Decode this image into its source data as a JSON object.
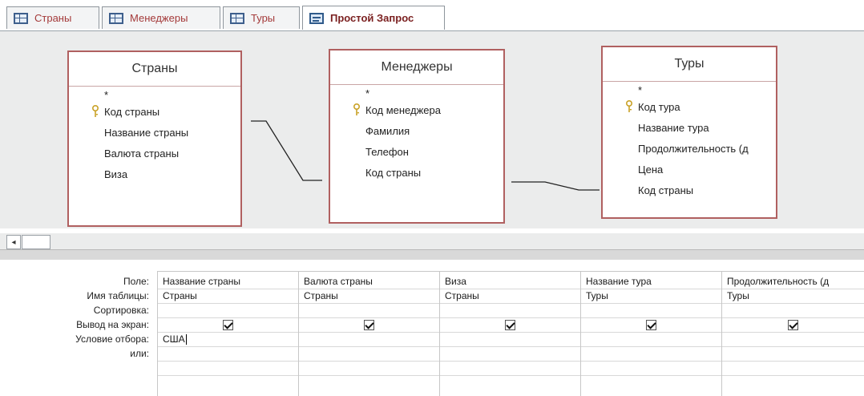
{
  "tabs": [
    {
      "label": "Страны",
      "icon": "table-icon"
    },
    {
      "label": "Менеджеры",
      "icon": "table-icon"
    },
    {
      "label": "Туры",
      "icon": "table-icon"
    },
    {
      "label": "Простой Запрос",
      "icon": "query-icon",
      "active": true
    }
  ],
  "tables": {
    "countries": {
      "title": "Страны",
      "star": "*",
      "fields": [
        "Код страны",
        "Название страны",
        "Валюта страны",
        "Виза"
      ],
      "key_field": "Код страны"
    },
    "managers": {
      "title": "Менеджеры",
      "star": "*",
      "fields": [
        "Код менеджера",
        "Фамилия",
        "Телефон",
        "Код страны"
      ],
      "key_field": "Код менеджера"
    },
    "tours": {
      "title": "Туры",
      "star": "*",
      "fields": [
        "Код тура",
        "Название тура",
        "Продолжительность (д",
        "Цена",
        "Код страны"
      ],
      "key_field": "Код тура"
    }
  },
  "grid": {
    "row_labels": [
      "Поле:",
      "Имя таблицы:",
      "Сортировка:",
      "Вывод на экран:",
      "Условие отбора:",
      "или:"
    ],
    "columns": [
      {
        "field": "Название страны",
        "table": "Страны",
        "sort": "",
        "show": true,
        "criteria": "США",
        "or": ""
      },
      {
        "field": "Валюта страны",
        "table": "Страны",
        "sort": "",
        "show": true,
        "criteria": "",
        "or": ""
      },
      {
        "field": "Виза",
        "table": "Страны",
        "sort": "",
        "show": true,
        "criteria": "",
        "or": ""
      },
      {
        "field": "Название тура",
        "table": "Туры",
        "sort": "",
        "show": true,
        "criteria": "",
        "or": ""
      },
      {
        "field": "Продолжительность (д",
        "table": "Туры",
        "sort": "",
        "show": true,
        "criteria": "",
        "or": ""
      }
    ]
  },
  "colors": {
    "tab_text": "#a43a3a",
    "table_border": "#b06060",
    "design_bg": "#ebecec",
    "key_icon": "#c9a227"
  },
  "scroll": {
    "left_arrow": "◂"
  }
}
